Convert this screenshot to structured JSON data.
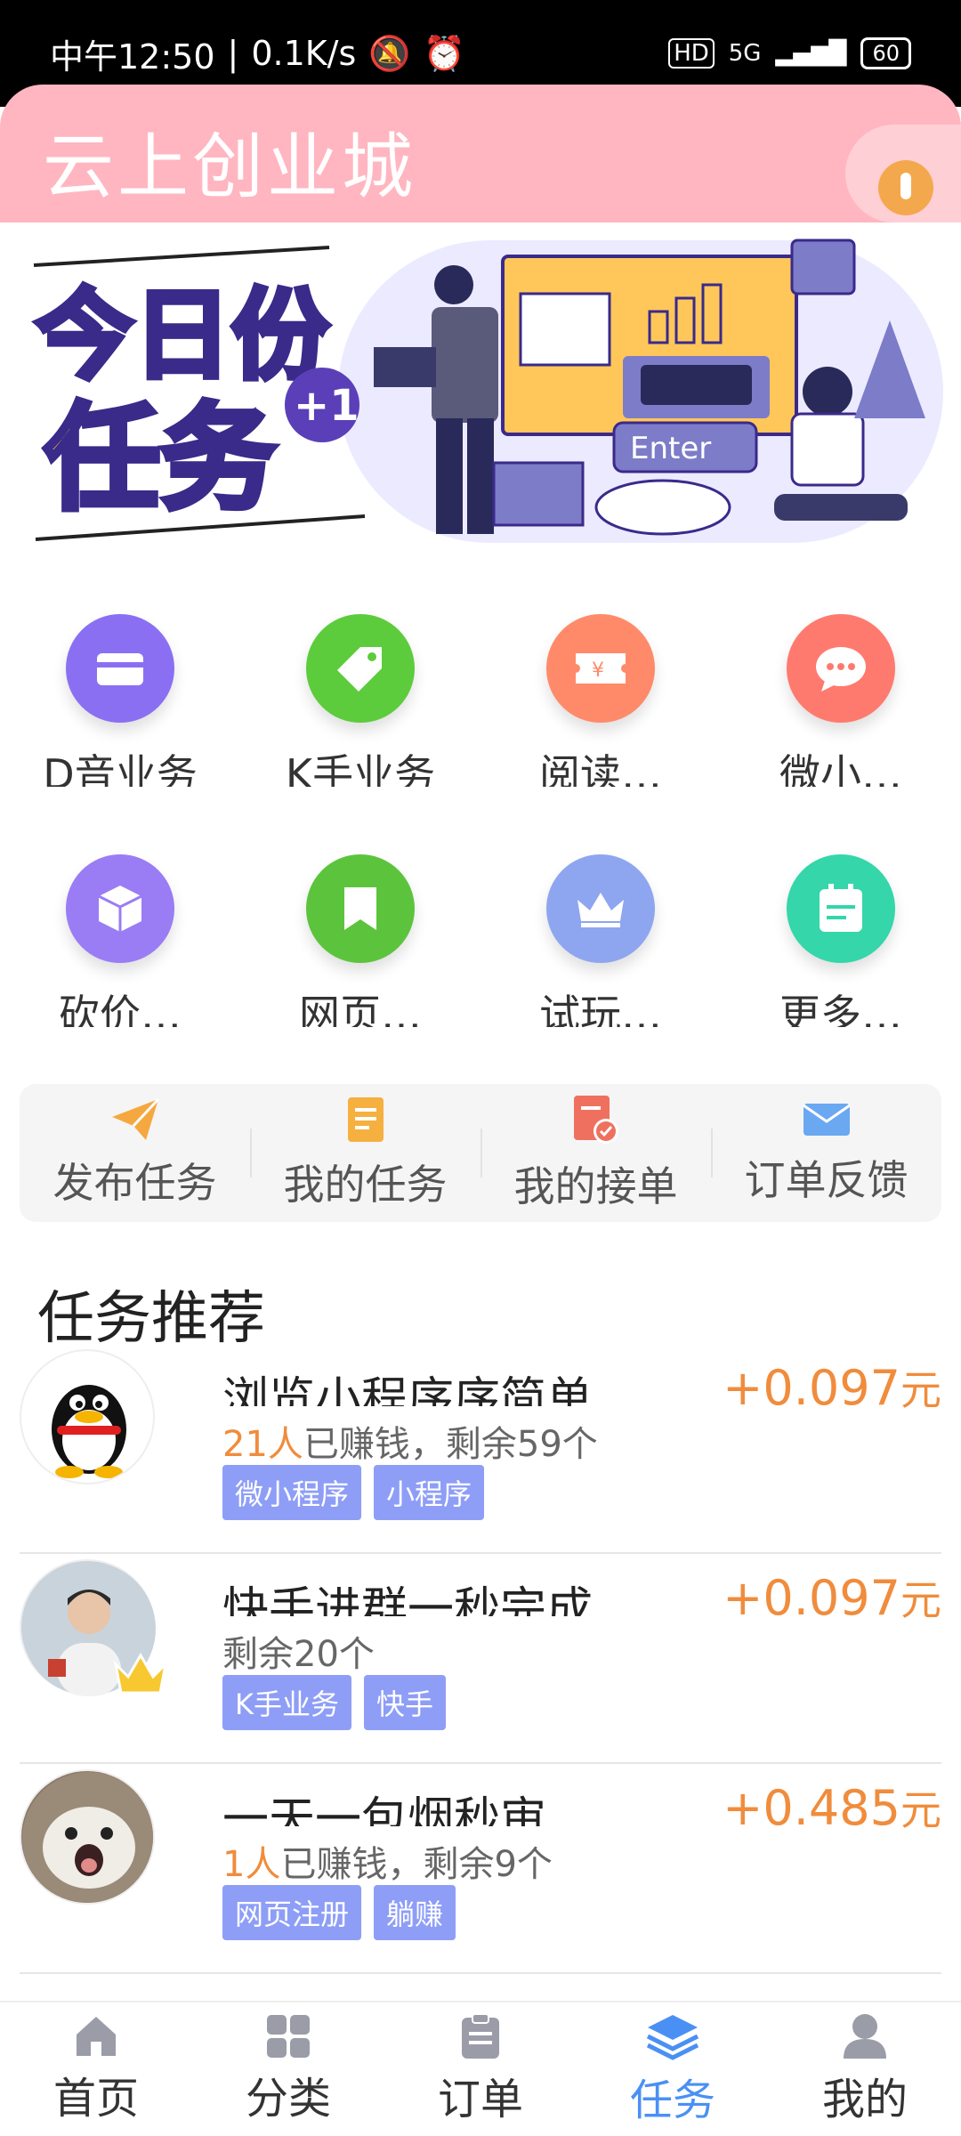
{
  "status": {
    "time": "中午12:50",
    "speed": "0.1K/s",
    "network": "5G",
    "battery": "60"
  },
  "header": {
    "title": "云上创业城"
  },
  "banner": {
    "line1": "今日份",
    "line2": "任务",
    "badge": "+1",
    "enter": "Enter"
  },
  "categories": [
    {
      "label": "D音业务",
      "color": "#8b6ff3",
      "icon": "card-icon"
    },
    {
      "label": "K手业务",
      "color": "#5ccc3c",
      "icon": "tag-icon"
    },
    {
      "label": "阅读…",
      "color": "#ff8a6a",
      "icon": "ticket-icon"
    },
    {
      "label": "微小…",
      "color": "#ff7a6e",
      "icon": "chat-icon"
    },
    {
      "label": "砍价…",
      "color": "#9a7cf5",
      "icon": "cube-icon"
    },
    {
      "label": "网页…",
      "color": "#5cc43c",
      "icon": "bookmark-icon"
    },
    {
      "label": "试玩…",
      "color": "#8ea6f0",
      "icon": "crown-icon"
    },
    {
      "label": "更多…",
      "color": "#34d6aa",
      "icon": "calendar-icon"
    }
  ],
  "quick_actions": [
    {
      "label": "发布任务",
      "icon": "paper-plane-icon",
      "color": "#f5a840"
    },
    {
      "label": "我的任务",
      "icon": "document-icon",
      "color": "#f5b040"
    },
    {
      "label": "我的接单",
      "icon": "order-check-icon",
      "color": "#f07060"
    },
    {
      "label": "订单反馈",
      "icon": "mail-icon",
      "color": "#6aa8f2"
    }
  ],
  "section": {
    "title": "任务推荐"
  },
  "tasks": [
    {
      "title": "浏览小程序序简单",
      "count": "21人",
      "meta": "已赚钱，剩余59个",
      "tags": [
        "微小程序",
        "小程序"
      ],
      "reward": "+0.097",
      "unit": "元"
    },
    {
      "title": "快手进群一秒完成",
      "count": "",
      "meta": "剩余20个",
      "tags": [
        "K手业务",
        "快手"
      ],
      "reward": "+0.097",
      "unit": "元"
    },
    {
      "title": "一天一包烟秒审",
      "count": "1人",
      "meta": "已赚钱，剩余9个",
      "tags": [
        "网页注册",
        "躺赚"
      ],
      "reward": "+0.485",
      "unit": "元"
    }
  ],
  "tabbar": [
    {
      "label": "首页",
      "icon": "home-icon"
    },
    {
      "label": "分类",
      "icon": "grid-icon"
    },
    {
      "label": "订单",
      "icon": "clipboard-icon"
    },
    {
      "label": "任务",
      "icon": "layers-icon",
      "active": true
    },
    {
      "label": "我的",
      "icon": "user-icon"
    }
  ]
}
